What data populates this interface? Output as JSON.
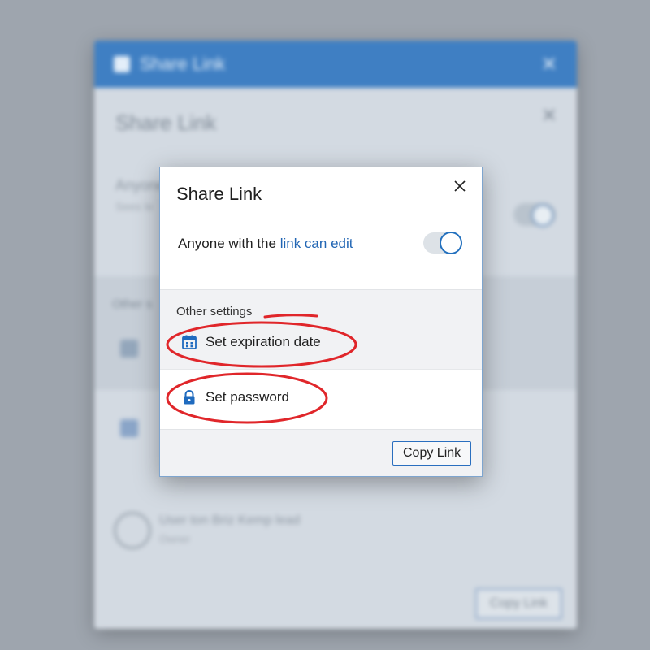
{
  "background_window": {
    "title": "Share Link",
    "heading": "Share Link",
    "anyone_text": "Anyone",
    "subtext": "Sees le",
    "other_label": "Other s",
    "user_line": "User ton Briz Kemp lead",
    "user_sub": "Owner",
    "copy_label": "Copy Link"
  },
  "dialog": {
    "title": "Share Link",
    "anyone_prefix": "Anyone with the ",
    "anyone_link": "link can edit",
    "link_toggle_on": true,
    "other_settings_label": "Other settings",
    "expiration_label": "Set expiration date",
    "password_label": "Set password",
    "copy_link_label": "Copy Link"
  },
  "icons": {
    "close": "close-icon",
    "calendar": "calendar-icon",
    "lock": "lock-icon"
  },
  "colors": {
    "accent": "#2270be",
    "annotation": "#e0262a",
    "titlebar": "#3f7fc3"
  }
}
